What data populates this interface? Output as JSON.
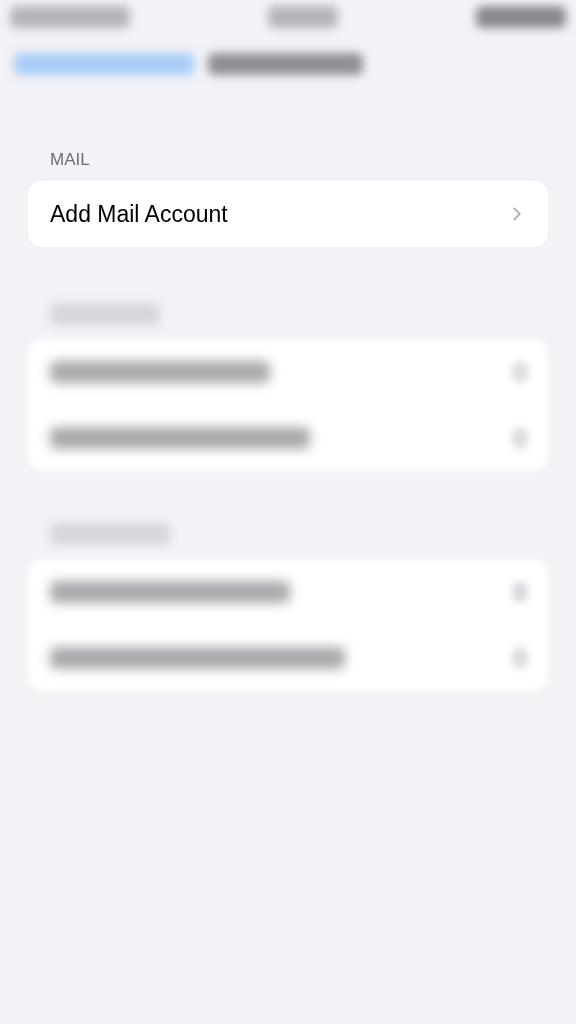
{
  "sections": [
    {
      "header": "MAIL",
      "rows": [
        {
          "label": "Add Mail Account"
        }
      ]
    }
  ]
}
